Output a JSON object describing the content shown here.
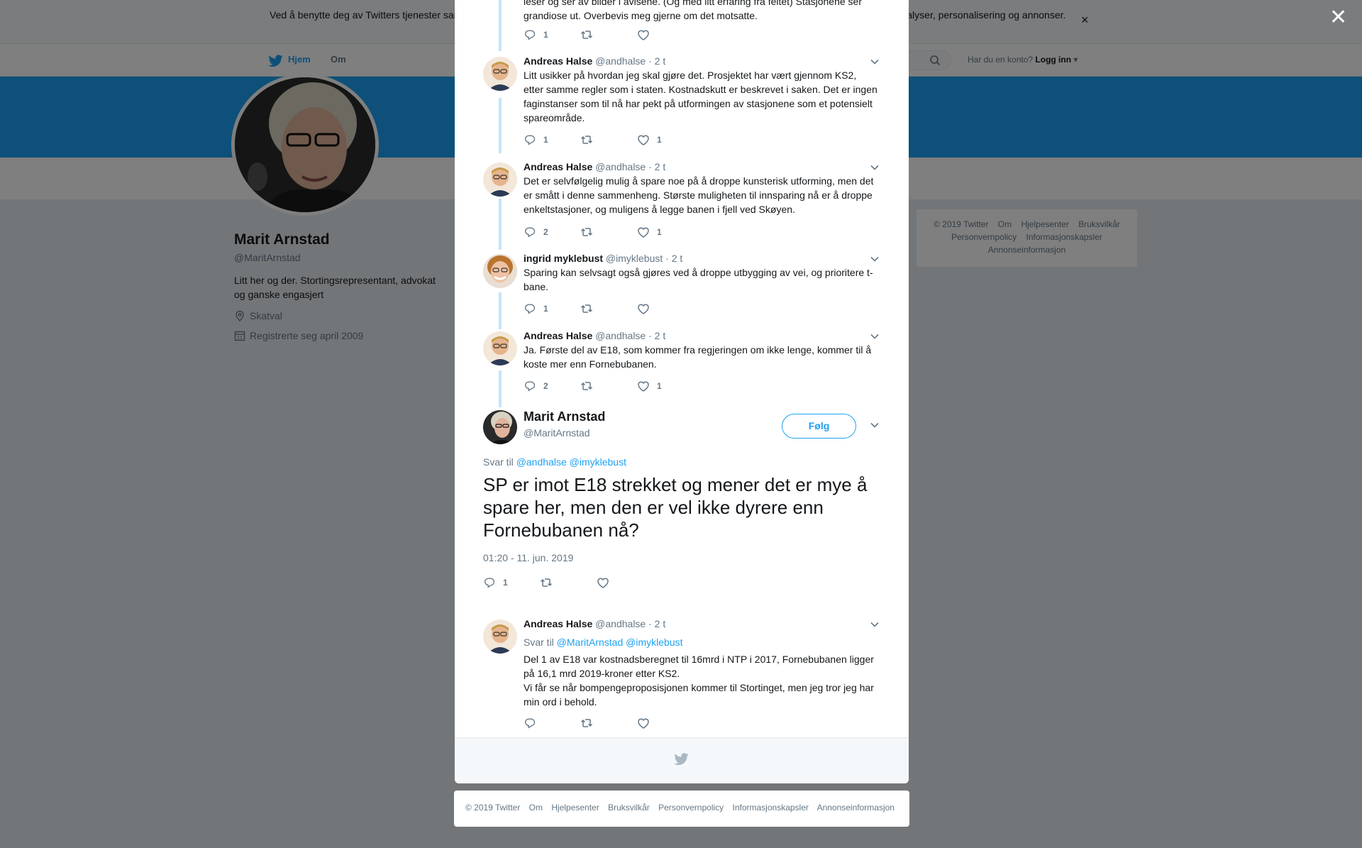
{
  "cookie_bar": {
    "text": "Ved å benytte deg av Twitters tjenester samtykker du i vår bruk av informasjonskapsler. Vi og våre partnere bruker informasjonskapsler til bl.a. analyser, personalisering og annonser.",
    "close_icon": "close-icon"
  },
  "nav": {
    "home": "Hjem",
    "about": "Om",
    "account_prompt": "Har du en konto?",
    "login": "Logg inn"
  },
  "profile": {
    "name": "Marit Arnstad",
    "handle": "@MaritArnstad",
    "bio": "Litt her og der. Stortingsrepresentant, advokat og ganske engasjert",
    "location": "Skatval",
    "joined": "Registrerte seg april 2009"
  },
  "side_footer": [
    "© 2019 Twitter",
    "Om",
    "Hjelpesenter",
    "Bruksvilkår",
    "Personvernpolicy",
    "Informasjonskapsler",
    "Annonseinformasjon"
  ],
  "thread": {
    "partial_text": "leser og ser av bilder i avisene. (Og med litt erfaring fra feltet) Stasjonene ser grandiose ut. Overbevis meg gjerne om det motsatte.",
    "partial_replies": "1",
    "tweets": [
      {
        "name": "Andreas Halse",
        "handle": "@andhalse",
        "time": "· 2 t",
        "text": "Litt usikker på hvordan jeg skal gjøre det. Prosjektet har vært gjennom KS2, etter samme regler som i staten. Kostnadskutt er beskrevet i saken. Det er ingen faginstanser som til nå har pekt på utformingen av stasjonene som et potensielt spareområde.",
        "replies": "1",
        "likes": "1"
      },
      {
        "name": "Andreas Halse",
        "handle": "@andhalse",
        "time": "· 2 t",
        "text": "Det er selvfølgelig mulig å spare noe på å droppe kunsterisk utforming, men det er smått i denne sammenheng. Største muligheten til innsparing nå er å droppe enkeltstasjoner, og muligens å legge banen i fjell ved Skøyen.",
        "replies": "2",
        "likes": "1"
      },
      {
        "name": "ingrid myklebust",
        "handle": "@imyklebust",
        "time": "· 2 t",
        "text": "Sparing kan selvsagt også gjøres ved å droppe utbygging av vei, og prioritere t-bane.",
        "replies": "1",
        "likes": ""
      },
      {
        "name": "Andreas Halse",
        "handle": "@andhalse",
        "time": "· 2 t",
        "text": "Ja. Første del av E18, som kommer fra regjeringen om ikke lenge, kommer til å koste mer enn Fornebubanen.",
        "replies": "2",
        "likes": "1"
      }
    ],
    "main": {
      "name": "Marit Arnstad",
      "handle": "@MaritArnstad",
      "follow": "Følg",
      "reply_label": "Svar til",
      "reply_to_1": "@andhalse",
      "reply_to_2": "@imyklebust",
      "text": "SP er imot E18 strekket og mener det er mye å spare her, men den er vel ikke dyrere enn Fornebubanen nå?",
      "timestamp": "01:20 - 11. jun. 2019",
      "replies": "1"
    },
    "reply": {
      "name": "Andreas Halse",
      "handle": "@andhalse",
      "time": "· 2 t",
      "reply_label": "Svar til",
      "reply_to_1": "@MaritArnstad",
      "reply_to_2": "@imyklebust",
      "text_1": "Del 1 av E18 var kostnadsberegnet til 16mrd i NTP i 2017, Fornebubanen ligger på 16,1 mrd 2019-kroner etter KS2.",
      "text_2": "Vi får se når bompengeproposisjonen kommer til Stortinget, men jeg tror jeg har min ord i behold."
    }
  },
  "bottom_footer": [
    "© 2019 Twitter",
    "Om",
    "Hjelpesenter",
    "Bruksvilkår",
    "Personvernpolicy",
    "Informasjonskapsler",
    "Annonseinformasjon"
  ],
  "colors": {
    "accent": "#1da1f2",
    "thread_line": "#c4e5fb",
    "muted": "#657786"
  }
}
